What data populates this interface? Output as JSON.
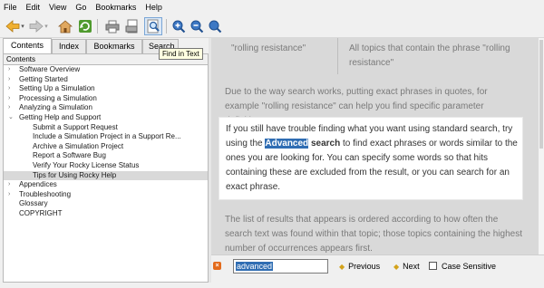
{
  "menu": [
    "File",
    "Edit",
    "View",
    "Go",
    "Bookmarks",
    "Help"
  ],
  "toolbar": {
    "tooltip": "Find in Text",
    "icons": [
      "back-icon",
      "forward-icon",
      "home-icon",
      "sync-icon",
      "print-icon",
      "page-setup-icon",
      "find-in-text-icon",
      "zoom-in-icon",
      "zoom-out-icon",
      "zoom-reset-icon"
    ]
  },
  "tabs": [
    "Contents",
    "Index",
    "Bookmarks",
    "Search"
  ],
  "pane_title": "Contents",
  "tree": [
    {
      "label": "Software Overview",
      "indent": 0,
      "arrow": "›"
    },
    {
      "label": "Getting Started",
      "indent": 0,
      "arrow": "›"
    },
    {
      "label": "Setting Up a Simulation",
      "indent": 0,
      "arrow": "›"
    },
    {
      "label": "Processing a Simulation",
      "indent": 0,
      "arrow": "›"
    },
    {
      "label": "Analyzing a Simulation",
      "indent": 0,
      "arrow": "›"
    },
    {
      "label": "Getting Help and Support",
      "indent": 0,
      "arrow": "⌄"
    },
    {
      "label": "Submit a Support Request",
      "indent": 1,
      "arrow": ""
    },
    {
      "label": "Include a Simulation Project in a Support Re...",
      "indent": 1,
      "arrow": ""
    },
    {
      "label": "Archive a Simulation Project",
      "indent": 1,
      "arrow": ""
    },
    {
      "label": "Report a Software Bug",
      "indent": 1,
      "arrow": ""
    },
    {
      "label": "Verify Your Rocky License Status",
      "indent": 1,
      "arrow": ""
    },
    {
      "label": "Tips for Using Rocky Help",
      "indent": 1,
      "arrow": "",
      "highlight": true
    },
    {
      "label": "Appendices",
      "indent": 0,
      "arrow": "›"
    },
    {
      "label": "Troubleshooting",
      "indent": 0,
      "arrow": "›"
    },
    {
      "label": "Glossary",
      "indent": 0,
      "arrow": ""
    },
    {
      "label": "COPYRIGHT",
      "indent": 0,
      "arrow": ""
    }
  ],
  "content": {
    "table_cell_1": "\"rolling resistance\"",
    "table_cell_2": "All topics that contain the phrase \"rolling resistance\"",
    "para1": "Due to the way search works, putting exact phrases in quotes, for example \"rolling resistance\" can help you find specific parameter definitions.",
    "para2_pre": "If you still have trouble finding what you want using standard search, try using the ",
    "para2_kw1": "Advanced",
    "para2_kw2": "search",
    "para2_post": " to find exact phrases or words similar to the ones you are looking for. You can specify some words so that hits containing these are excluded from the result, or you can search for an exact phrase.",
    "para3": "The list of results that appears is ordered according to how often the search text was found within that topic; those topics containing the highest number of occurrences appears first."
  },
  "findbar": {
    "query": "advanced",
    "previous": "Previous",
    "next": "Next",
    "case_sensitive": "Case Sensitive"
  }
}
